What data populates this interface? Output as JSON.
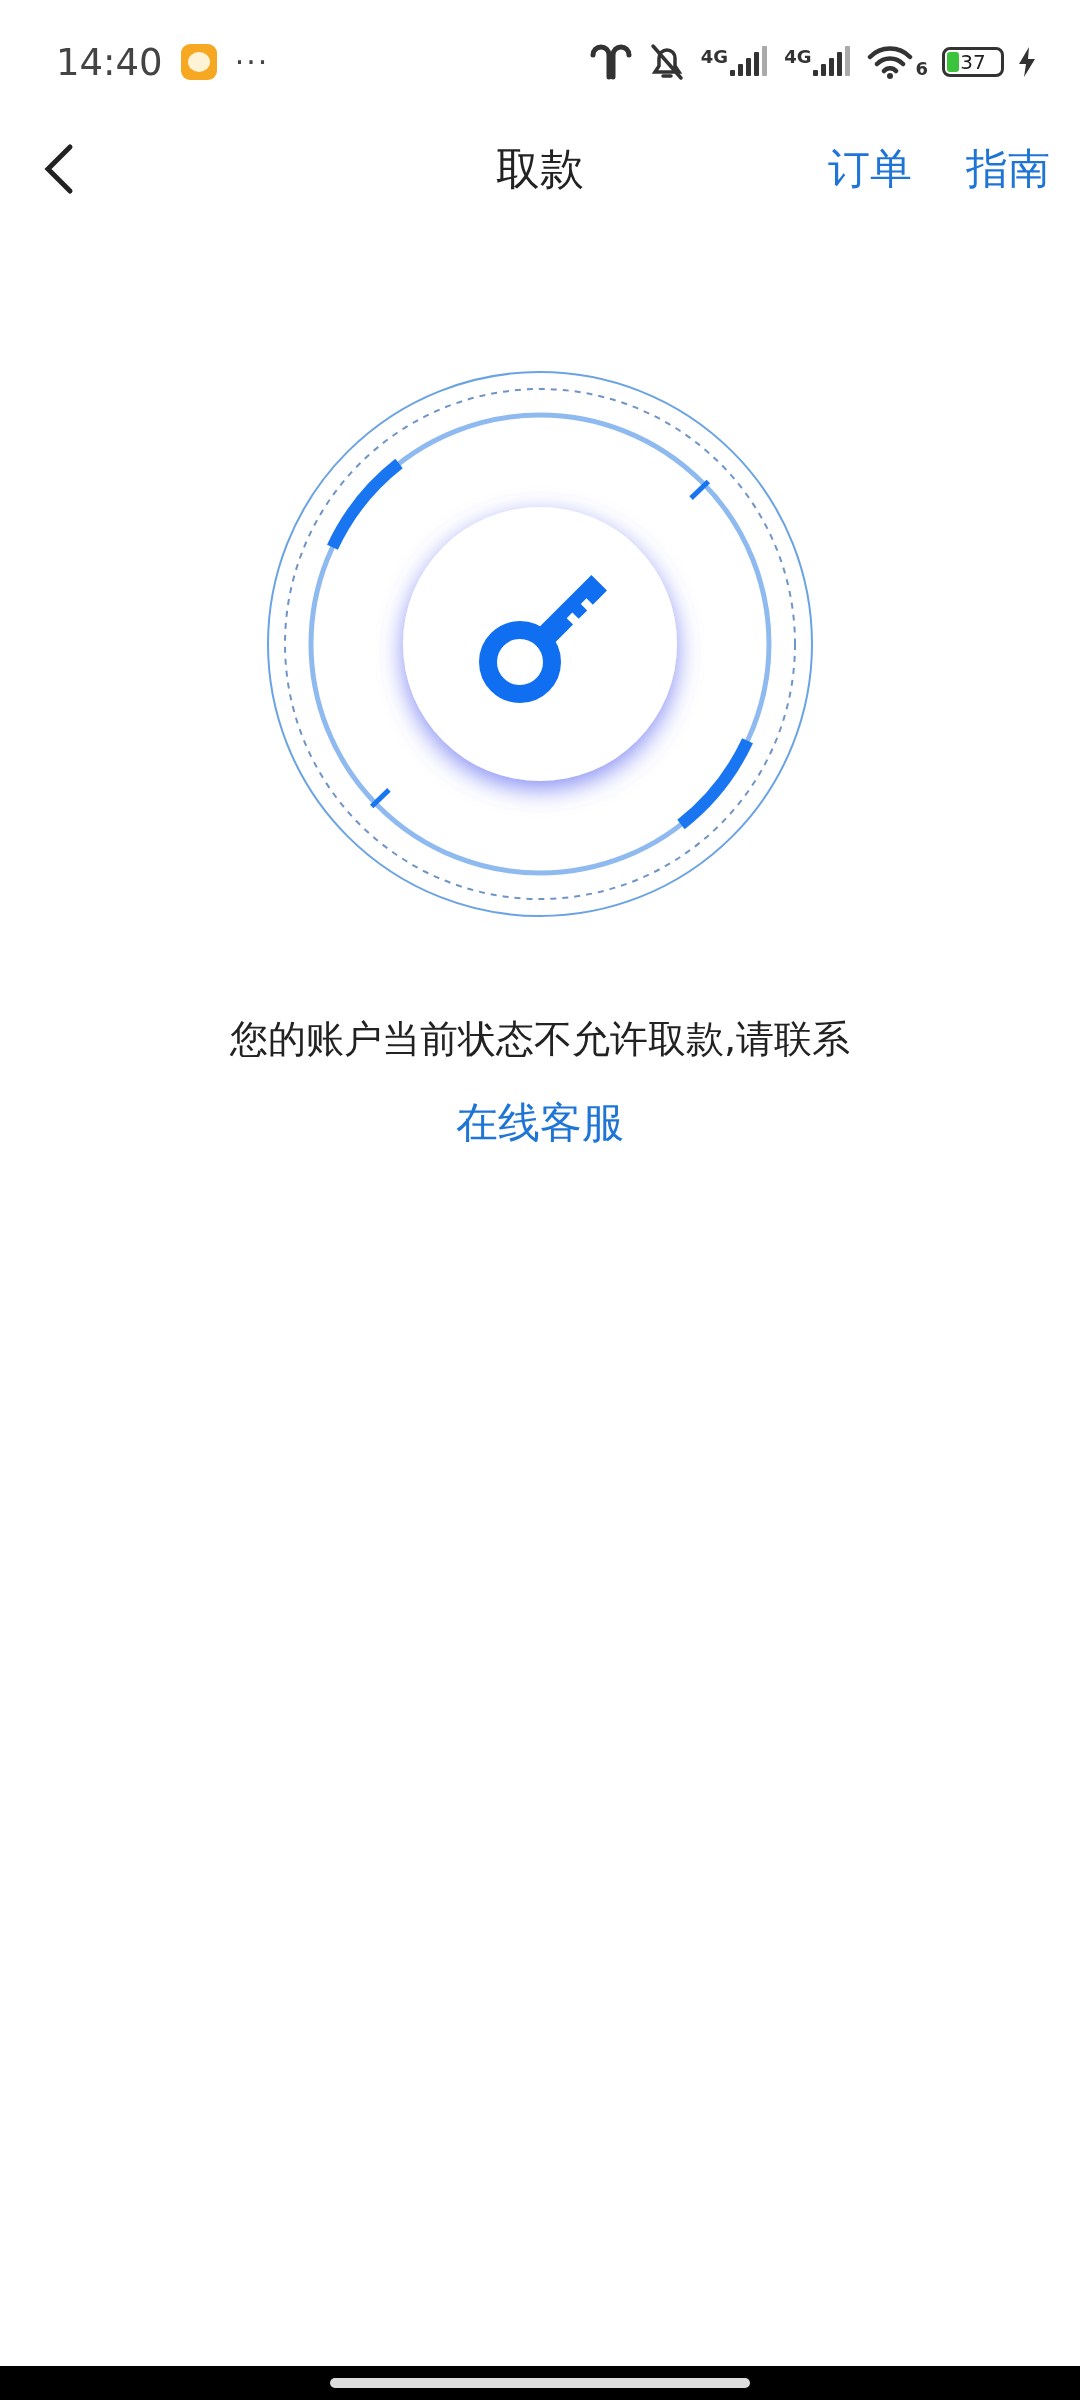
{
  "status_bar": {
    "time": "14:40",
    "more": "···",
    "signals": [
      {
        "network": "4G"
      },
      {
        "network": "4G"
      }
    ],
    "wifi_band": "6",
    "battery": "37"
  },
  "nav": {
    "title": "取款",
    "actions": [
      "订单",
      "指南"
    ]
  },
  "message": {
    "text": "您的账户当前状态不允许取款,请联系",
    "link": "在线客服"
  }
}
